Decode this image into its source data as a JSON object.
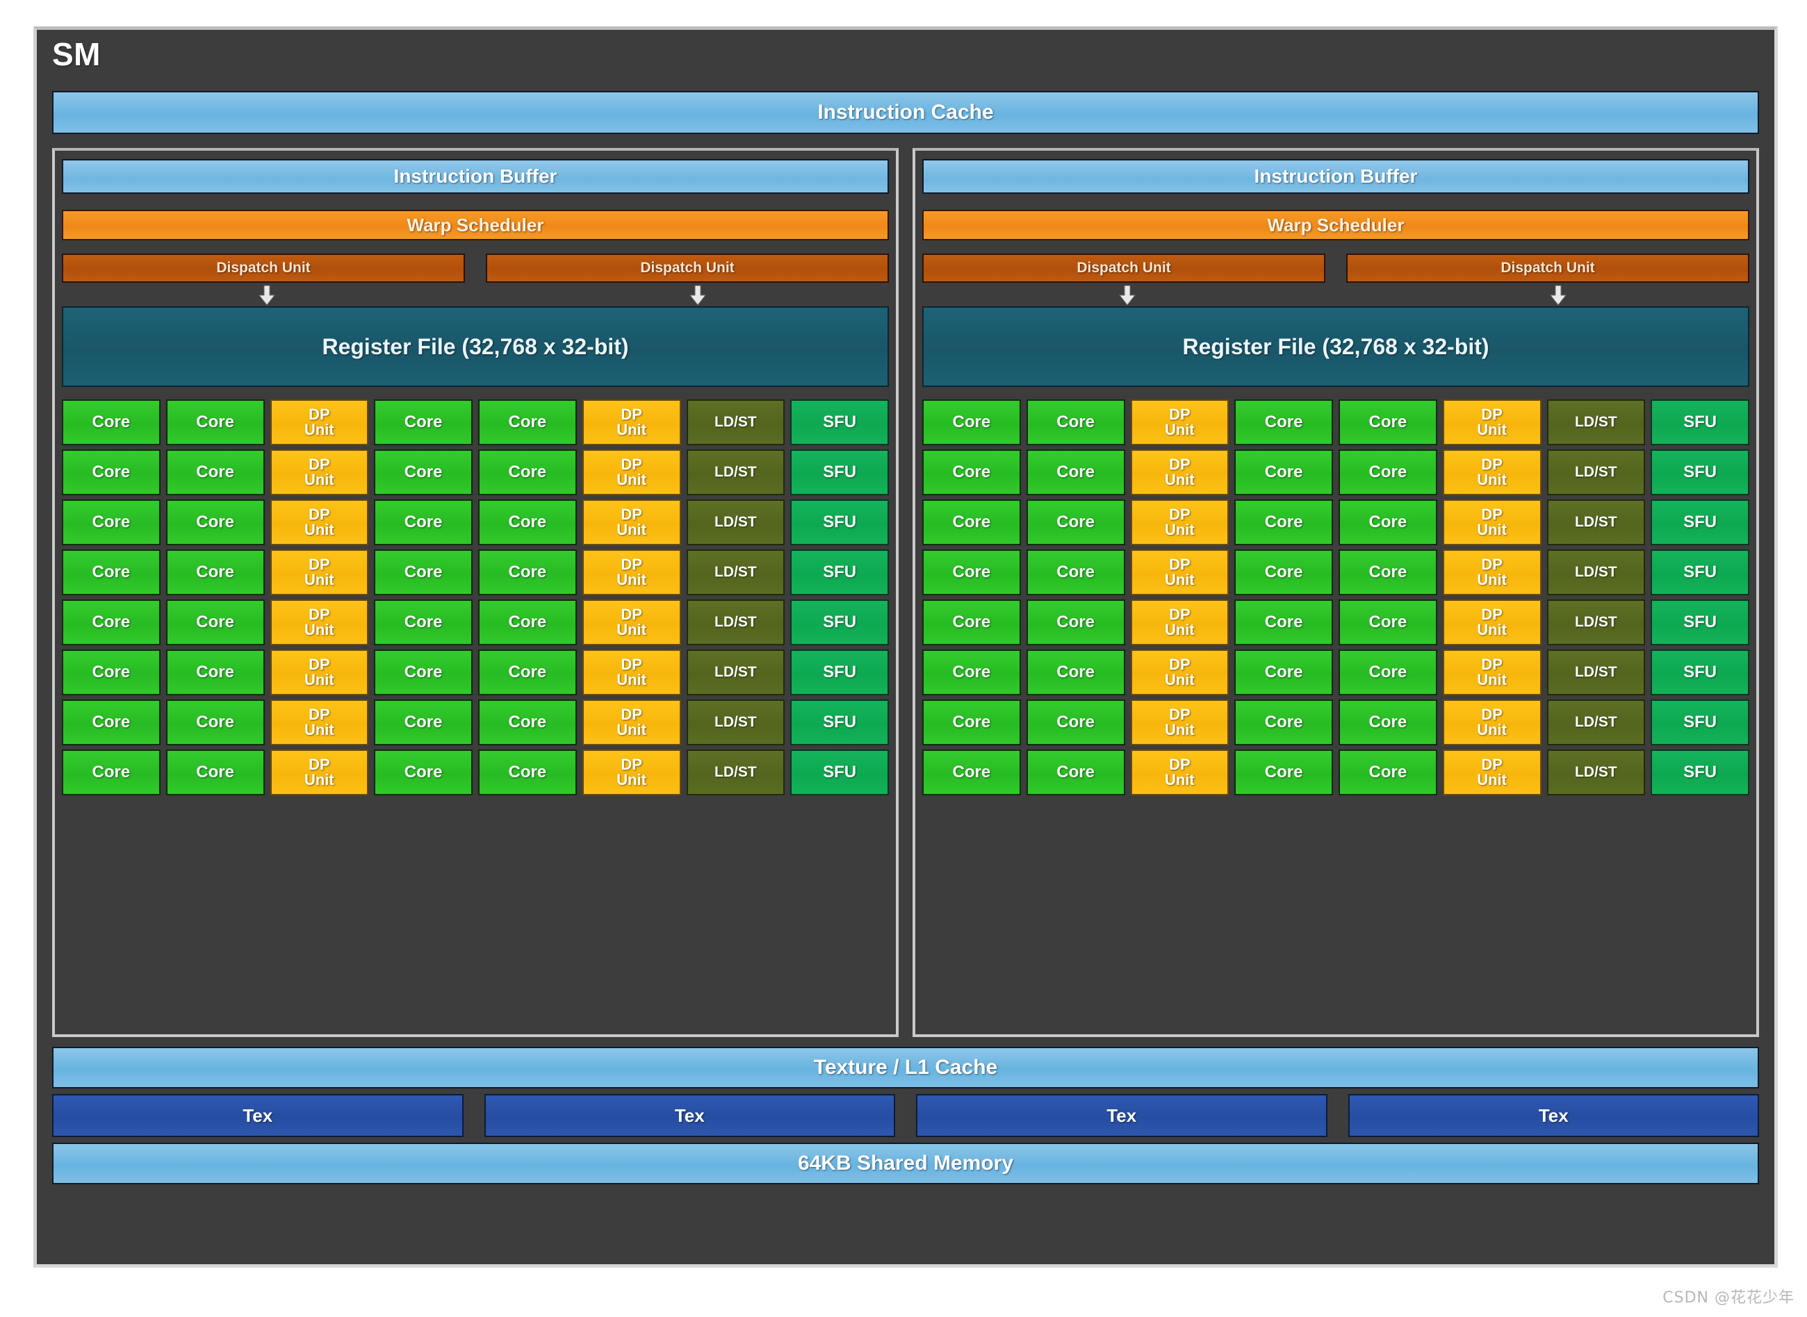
{
  "diagram": {
    "title": "SM",
    "instruction_cache": "Instruction Cache",
    "texture_l1_cache": "Texture / L1 Cache",
    "shared_memory": "64KB Shared Memory",
    "tex_blocks": [
      "Tex",
      "Tex",
      "Tex",
      "Tex"
    ],
    "watermark": "CSDN @花花少年"
  },
  "panels": [
    {
      "instruction_buffer": "Instruction Buffer",
      "warp_scheduler": "Warp Scheduler",
      "dispatch_units": [
        "Dispatch Unit",
        "Dispatch Unit"
      ],
      "register_file": "Register File (32,768 x 32-bit)",
      "arrow_icons": [
        "arrow-down-icon",
        "arrow-down-icon"
      ]
    },
    {
      "instruction_buffer": "Instruction Buffer",
      "warp_scheduler": "Warp Scheduler",
      "dispatch_units": [
        "Dispatch Unit",
        "Dispatch Unit"
      ],
      "register_file": "Register File (32,768 x 32-bit)",
      "arrow_icons": [
        "arrow-down-icon",
        "arrow-down-icon"
      ]
    }
  ],
  "execution_units": {
    "row_pattern": [
      "Core",
      "Core",
      "DP Unit",
      "Core",
      "Core",
      "DP Unit",
      "LD/ST",
      "SFU"
    ],
    "rows_per_panel": 8,
    "labels": {
      "core": "Core",
      "dp_unit_line1": "DP",
      "dp_unit_line2": "Unit",
      "ldst": "LD/ST",
      "sfu": "SFU"
    }
  },
  "colors": {
    "frame_background": "#3d3d3d",
    "frame_border": "#d8d8d8",
    "cache_blue": "#6fb6e2",
    "warp_scheduler_orange": "#f0881a",
    "dispatch_unit_brown": "#b1500c",
    "register_file_teal": "#195668",
    "core_green": "#28bb24",
    "dp_unit_yellow": "#f8b60c",
    "ldst_olive": "#53651e",
    "sfu_green": "#0ea851",
    "tex_blue": "#264da1"
  }
}
